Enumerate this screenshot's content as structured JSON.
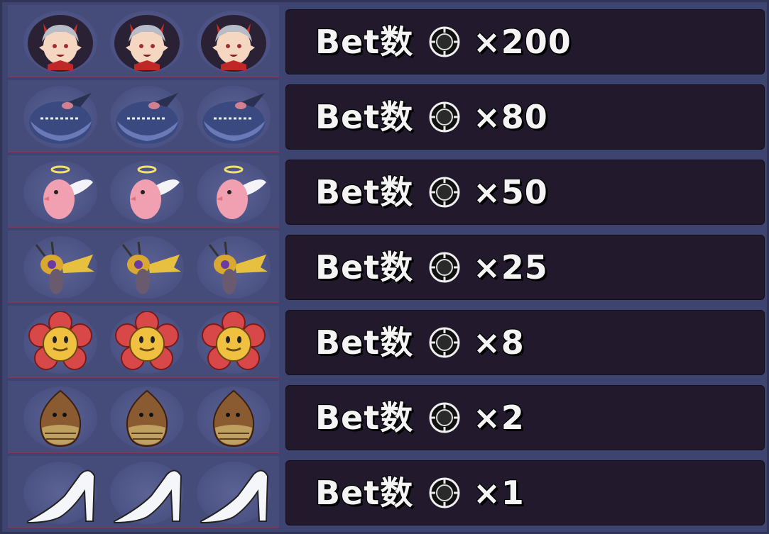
{
  "rows": [
    {
      "symbol": "demon-girl",
      "bet_label": "Bet数",
      "multiplier": "×200"
    },
    {
      "symbol": "whale",
      "bet_label": "Bet数",
      "multiplier": "×80"
    },
    {
      "symbol": "angel-bird",
      "bet_label": "Bet数",
      "multiplier": "×50"
    },
    {
      "symbol": "bee",
      "bet_label": "Bet数",
      "multiplier": "×25"
    },
    {
      "symbol": "flower",
      "bet_label": "Bet数",
      "multiplier": "×8"
    },
    {
      "symbol": "chestnut",
      "bet_label": "Bet数",
      "multiplier": "×2"
    },
    {
      "symbol": "glass-slipper",
      "bet_label": "Bet数",
      "multiplier": "×1"
    }
  ],
  "colors": {
    "background": "#3d4470",
    "panel": "#221a2c",
    "divider": "#7a3a5c",
    "text": "#f4f4f4"
  },
  "icons": {
    "chip": "casino-chip-icon"
  }
}
